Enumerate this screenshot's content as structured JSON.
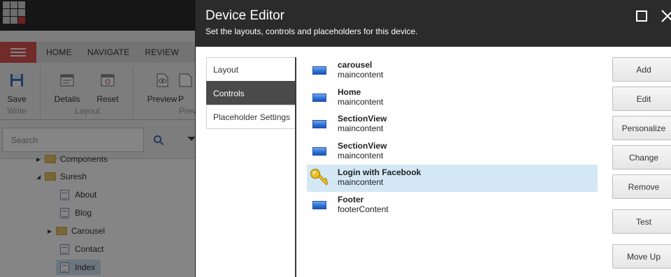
{
  "background_app": {
    "ribbon_tabs": [
      "HOME",
      "NAVIGATE",
      "REVIEW"
    ],
    "ribbon_buttons": {
      "save": "Save",
      "details": "Details",
      "reset": "Reset",
      "preview": "Preview",
      "preview_partial": "P"
    },
    "ribbon_groups": {
      "write": "Write",
      "layout": "Layout",
      "preview": "Previ"
    },
    "search": {
      "placeholder": "Search"
    },
    "tree": {
      "components": "Components",
      "suresh": "Suresh",
      "about": "About",
      "blog": "Blog",
      "carousel": "Carousel",
      "contact": "Contact",
      "index": "Index"
    }
  },
  "dialog": {
    "title": "Device Editor",
    "subtitle": "Set the layouts, controls and placeholders for this device.",
    "tabs": [
      "Layout",
      "Controls",
      "Placeholder Settings"
    ],
    "active_tab": "Controls",
    "controls": [
      {
        "name": "carousel",
        "placeholder": "maincontent",
        "icon": "rendering-icon"
      },
      {
        "name": "Home",
        "placeholder": "maincontent",
        "icon": "rendering-icon"
      },
      {
        "name": "SectionView",
        "placeholder": "maincontent",
        "icon": "rendering-icon"
      },
      {
        "name": "SectionView",
        "placeholder": "maincontent",
        "icon": "rendering-icon"
      },
      {
        "name": "Login with Facebook",
        "placeholder": "maincontent",
        "icon": "key-icon",
        "selected": true
      },
      {
        "name": "Footer",
        "placeholder": "footerContent",
        "icon": "rendering-icon"
      }
    ],
    "buttons": {
      "add": "Add",
      "edit": "Edit",
      "personalize": "Personalize",
      "change": "Change",
      "remove": "Remove",
      "test": "Test",
      "move_up": "Move Up"
    }
  },
  "colors": {
    "header_bg": "#2b2b2b",
    "selected_row": "#d3e8f4",
    "active_tab": "#4a4a4a",
    "hamburger": "#d9534f"
  }
}
